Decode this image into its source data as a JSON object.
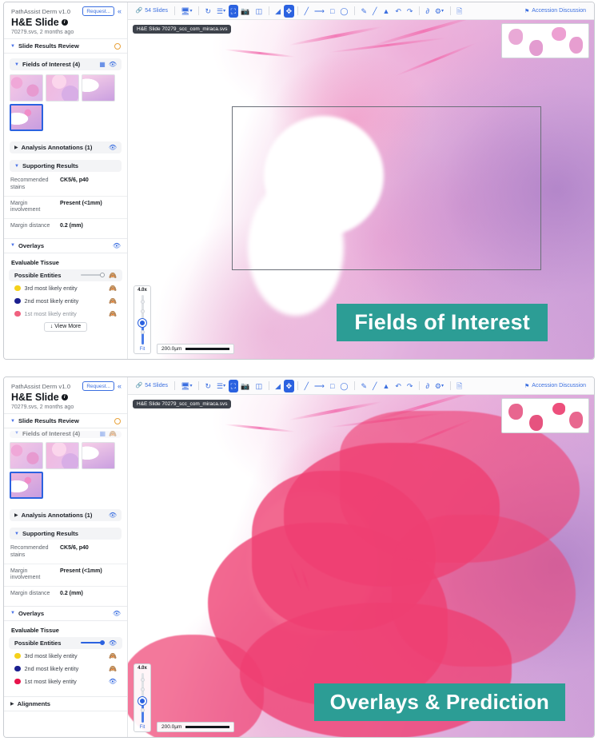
{
  "app": {
    "product": "PathAssist Derm v1.0",
    "request_button": "Request...",
    "collapse_icon": "chevrons-left-icon",
    "title": "H&E Slide",
    "subtitle": "70279.svs, 2 months ago"
  },
  "sidebar": {
    "slide_results_review": "Slide Results Review",
    "fields_of_interest": "Fields of Interest (4)",
    "analysis_annotations": "Analysis Annotations (1)",
    "supporting_results": "Supporting Results",
    "overlays": "Overlays",
    "alignments": "Alignments",
    "evaluable_tissue": "Evaluable Tissue",
    "view_more": "View More",
    "thumbnail_count": 4,
    "selected_thumbnail": 4,
    "supporting_rows": [
      {
        "key": "Recommended stains",
        "value": "CK5/6, p40"
      },
      {
        "key": "Margin involvement",
        "value": "Present (<1mm)"
      },
      {
        "key": "Margin distance",
        "value": "0.2 (mm)"
      }
    ],
    "overlay_rows_top": [
      {
        "label": "Possible Entities",
        "type": "slider",
        "slider_value": 0,
        "visible": false,
        "color": ""
      },
      {
        "label": "3rd most likely entity",
        "type": "entity",
        "visible": false,
        "color": "#f5d11a"
      },
      {
        "label": "2nd most likely entity",
        "type": "entity",
        "visible": false,
        "color": "#1b1f8f"
      },
      {
        "label": "1st most likely entity",
        "type": "entity",
        "visible": false,
        "color": "#f0617f"
      }
    ],
    "overlay_rows_bottom": [
      {
        "label": "Possible Entities",
        "type": "slider",
        "slider_value": 100,
        "visible": true,
        "color": ""
      },
      {
        "label": "3rd most likely entity",
        "type": "entity",
        "visible": false,
        "color": "#f5d11a"
      },
      {
        "label": "2nd most likely entity",
        "type": "entity",
        "visible": false,
        "color": "#1b1f8f"
      },
      {
        "label": "1st most likely entity",
        "type": "entity",
        "visible": true,
        "color": "#e8144b"
      }
    ]
  },
  "toolbar": {
    "slides_count_label": "54 Slides",
    "slides_icon": "link-icon",
    "items": [
      {
        "name": "display-mode",
        "icon": "monitor-icon",
        "caret": true,
        "active": false
      },
      {
        "name": "rotate",
        "icon": "rotate-icon",
        "caret": false,
        "active": false
      },
      {
        "name": "layout",
        "icon": "layers-icon",
        "caret": true,
        "active": false
      },
      {
        "name": "fit-screen",
        "icon": "fit-screen-icon",
        "caret": false,
        "active": true
      },
      {
        "name": "snapshot",
        "icon": "camera-icon",
        "caret": false,
        "active": false
      },
      {
        "name": "filmstrip",
        "icon": "filmstrip-icon",
        "caret": false,
        "active": false
      },
      {
        "name": "measure-area",
        "icon": "area-icon",
        "caret": false,
        "active": false
      },
      {
        "name": "pan",
        "icon": "move-icon",
        "caret": false,
        "active": true
      },
      {
        "name": "line-tool",
        "icon": "line-icon",
        "caret": false,
        "active": false
      },
      {
        "name": "arrow-tool",
        "icon": "arrow-icon",
        "caret": false,
        "active": false
      },
      {
        "name": "rectangle-tool",
        "icon": "square-icon",
        "caret": false,
        "active": false
      },
      {
        "name": "ellipse-tool",
        "icon": "circle-icon",
        "caret": false,
        "active": false
      },
      {
        "name": "pen-tool",
        "icon": "pen-icon",
        "caret": false,
        "active": false
      },
      {
        "name": "brush-tool",
        "icon": "brush-icon",
        "caret": false,
        "active": false
      },
      {
        "name": "highlighter-tool",
        "icon": "marker-icon",
        "caret": false,
        "active": false
      },
      {
        "name": "stamp-tool",
        "icon": "stamp-icon",
        "caret": false,
        "active": false
      },
      {
        "name": "undo",
        "icon": "undo-icon",
        "caret": false,
        "active": false
      },
      {
        "name": "redo",
        "icon": "redo-icon",
        "caret": false,
        "active": false
      },
      {
        "name": "share",
        "icon": "share-icon",
        "caret": false,
        "active": false
      },
      {
        "name": "settings",
        "icon": "gear-icon",
        "caret": true,
        "active": false
      },
      {
        "name": "notes",
        "icon": "note-add-icon",
        "caret": false,
        "active": false
      }
    ],
    "accession_discussion": "Accession Discussion",
    "accession_icon": "flag-icon"
  },
  "viewer": {
    "slide_chip": "H&E Slide 70279_scc_com_miraca.svs",
    "zoom_value": "4.0x",
    "zoom_fit_label": "Fit",
    "scalebar_label": "200.0µm",
    "minimap_name": "slide-minimap"
  },
  "captions": {
    "top": "Fields of Interest",
    "bottom": "Overlays & Prediction",
    "color": "#2c9d95"
  }
}
